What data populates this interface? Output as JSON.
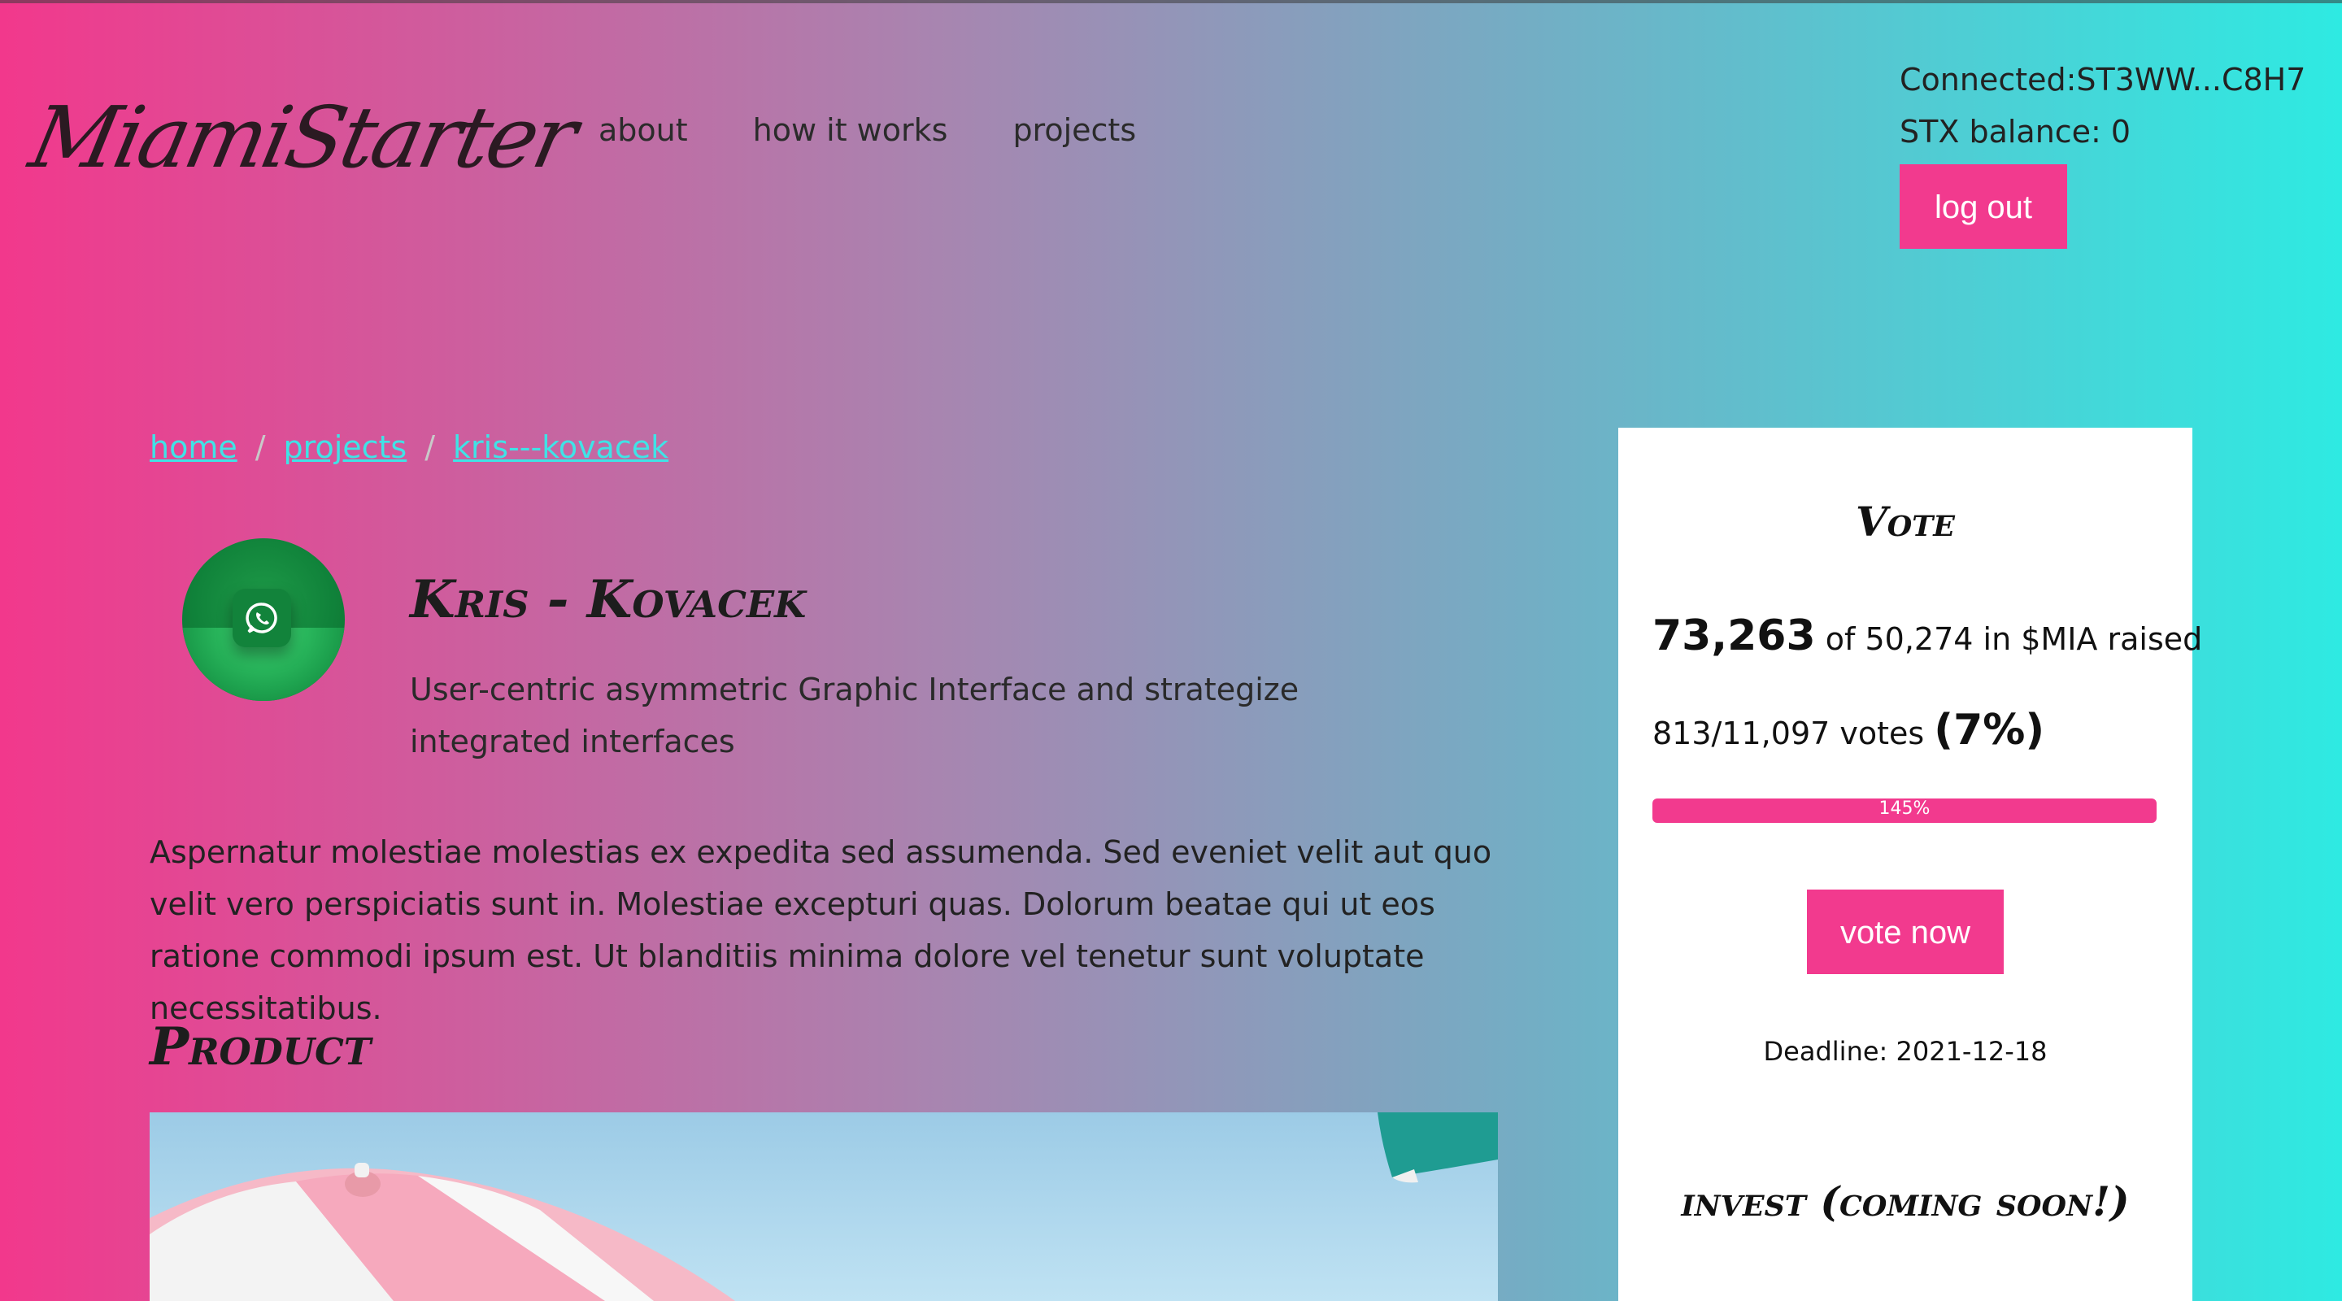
{
  "header": {
    "logo": "MiamiStarter",
    "nav": [
      "about",
      "how it works",
      "projects"
    ],
    "connected_label": "Connected:ST3WW...C8H7",
    "balance_label": "STX balance: 0",
    "logout_label": "log out"
  },
  "breadcrumb": [
    "home",
    "projects",
    "kris---kovacek"
  ],
  "breadcrumb_separator": "/",
  "project": {
    "title": "Kris - Kovacek",
    "subtitle": "User-centric asymmetric Graphic Interface and strategize integrated interfaces",
    "description": "Aspernatur molestiae molestias ex expedita sed assumenda. Sed eveniet velit aut quo velit vero perspiciatis sunt in. Molestiae excepturi quas. Dolorum beatae qui ut eos ratione commodi ipsum est. Ut blanditiis minima dolore vel tenetur sunt voluptate necessitatibus.",
    "section_heading": "Product",
    "icon": "whatsapp-icon"
  },
  "vote_panel": {
    "heading": "Vote",
    "raised_amount": "73,263",
    "raised_rest": "of 50,274 in $MIA raised",
    "votes_text": "813/11,097 votes",
    "votes_percent": "(7%)",
    "progress_label": "145%",
    "progress_fraction": 1.0,
    "vote_button": "vote now",
    "deadline": "Deadline: 2021-12-18",
    "invest_heading": "invest (coming soon!)"
  },
  "colors": {
    "accent": "#f23a8e",
    "link": "#3fe3e6",
    "gradient_start": "#f2388c",
    "gradient_end": "#2eeae2"
  }
}
